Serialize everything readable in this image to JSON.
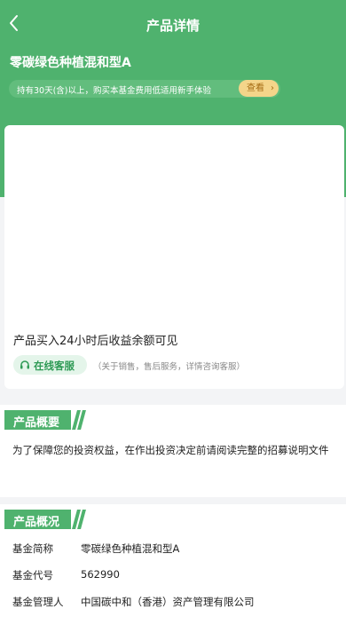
{
  "nav": {
    "title": "产品详情"
  },
  "fund": {
    "name": "零碳绿色种植混和型A"
  },
  "notice": {
    "text": "持有30天(含)以上，购买本基金费用低适用新手体验",
    "button": "查看"
  },
  "card": {
    "message": "产品买入24小时后收益余额可见",
    "service_label": "在线客服",
    "service_note": "（关于销售，售后服务，详情咨询客服）"
  },
  "overview": {
    "title": "产品概要",
    "text": "为了保障您的投资权益，在作出投资决定前请阅读完整的招募说明文件"
  },
  "summary": {
    "title": "产品概况",
    "rows": [
      {
        "key": "基金简称",
        "value": "零碳绿色种植混和型A"
      },
      {
        "key": "基金代号",
        "value": "562990"
      },
      {
        "key": "基金管理人",
        "value": "中国碳中和（香港）资产管理有限公司"
      }
    ]
  },
  "colors": {
    "brand_green": "#4fb26e",
    "badge_yellow": "#f4d58a"
  },
  "icons": {
    "back": "chevron-left-icon",
    "service": "headset-icon"
  }
}
